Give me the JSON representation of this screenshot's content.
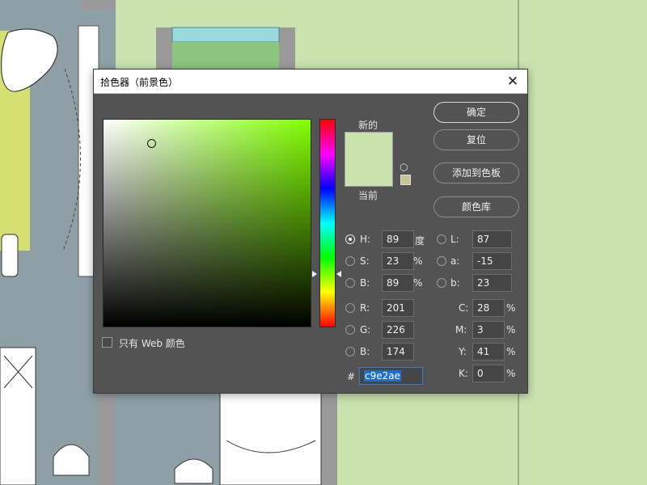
{
  "dialog": {
    "title": "拾色器（前景色）",
    "close_glyph": "✕",
    "new_label": "新的",
    "current_label": "当前",
    "new_color": "#c9e2ae",
    "current_color": "#c9e2ae",
    "gamut_warning_color": "#c8c590",
    "buttons": {
      "ok": "确定",
      "reset": "复位",
      "add_swatch": "添加到色板",
      "libraries": "颜色库"
    },
    "web_only_label": "只有 Web 颜色",
    "hsb": {
      "h": {
        "label": "H:",
        "value": "89",
        "unit": "度"
      },
      "s": {
        "label": "S:",
        "value": "23",
        "unit": "%"
      },
      "b": {
        "label": "B:",
        "value": "89",
        "unit": "%"
      }
    },
    "rgb": {
      "r": {
        "label": "R:",
        "value": "201"
      },
      "g": {
        "label": "G:",
        "value": "226"
      },
      "b": {
        "label": "B:",
        "value": "174"
      }
    },
    "lab": {
      "l": {
        "label": "L:",
        "value": "87"
      },
      "a": {
        "label": "a:",
        "value": "-15"
      },
      "b": {
        "label": "b:",
        "value": "23"
      }
    },
    "cmyk": {
      "c": {
        "label": "C:",
        "value": "28",
        "unit": "%"
      },
      "m": {
        "label": "M:",
        "value": "3",
        "unit": "%"
      },
      "y": {
        "label": "Y:",
        "value": "41",
        "unit": "%"
      },
      "k": {
        "label": "K:",
        "value": "0",
        "unit": "%"
      }
    },
    "hex": {
      "label": "#",
      "value": "c9e2ae"
    }
  }
}
